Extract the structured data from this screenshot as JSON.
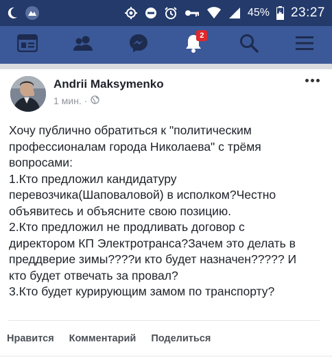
{
  "status_bar": {
    "battery": "45%",
    "time": "23:27"
  },
  "nav": {
    "items": [
      {
        "icon": "news-feed-icon"
      },
      {
        "icon": "friends-icon"
      },
      {
        "icon": "messenger-icon"
      },
      {
        "icon": "notifications-bell-icon",
        "badge": "2"
      },
      {
        "icon": "search-icon"
      },
      {
        "icon": "menu-icon"
      }
    ]
  },
  "post": {
    "author": "Andrii Maksymenko",
    "time": "1 мин. ·",
    "lines": [
      "Хочу публично обратиться к \"политическим",
      "профессионалам города Николаева\" с трёмя",
      "вопросами:",
      "1.Кто предложил кандидатуру",
      "перевозчика(Шаповаловой) в исполком?Честно",
      "объявитесь и объясните свою позицию.",
      "2.Кто предложил не продливать договор с",
      "директором КП Электротранса?Зачем это делать в",
      "преддверие зимы????и кто будет назначен????? И",
      "кто будет отвечать за провал?",
      "3.Кто будет курирующим замом по транспорту?"
    ],
    "actions": {
      "like": "Нравится",
      "comment": "Комментарий",
      "share": "Поделиться"
    }
  },
  "colors": {
    "status_bar": "#233a6b",
    "nav_bar": "#3b5998",
    "badge": "#e0282c"
  }
}
